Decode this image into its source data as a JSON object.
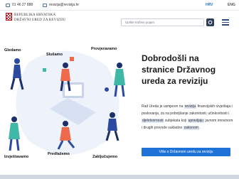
{
  "topbar": {
    "phone": "01 46 27 888",
    "email": "revizija@revizija.hr",
    "lang_hr": "HRV",
    "lang_en": "ENG"
  },
  "header": {
    "org_line1": "REPUBLIKA HRVATSKA",
    "org_line2": "DRŽAVNI URED ZA REVIZIJU",
    "search_placeholder": "Upište traženi pojam"
  },
  "illustration": {
    "labels": [
      "Gledamo",
      "Slušamo",
      "Provjeravamo",
      "Izvještavamo",
      "Predlažemo",
      "Zaključujemo"
    ]
  },
  "main": {
    "title": "Dobrodošli na stranice Državnog ureda za reviziju",
    "para": {
      "p1": "Rad Ureda je usmjeren na ",
      "h1": "reviziju",
      "p2": " financijskih izvještaja i poslovanja, za na poboljšanje zakonitosti, učinkovitosti i ",
      "h2": "djelotvornosti",
      "p3": " subjekata koji ",
      "h3": "upravljaju",
      "p4": " javnom imovinom i drugih provode sukladno ",
      "h4": "zakonom",
      "p5": "."
    },
    "cta": "Više o Državnom uredu za reviziju"
  },
  "colors": {
    "accent": "#1f73d6",
    "dark": "#2c3e58",
    "figure_blue": "#2c4aa0",
    "figure_orange": "#ef6a4a",
    "figure_green": "#3fb8a8"
  }
}
